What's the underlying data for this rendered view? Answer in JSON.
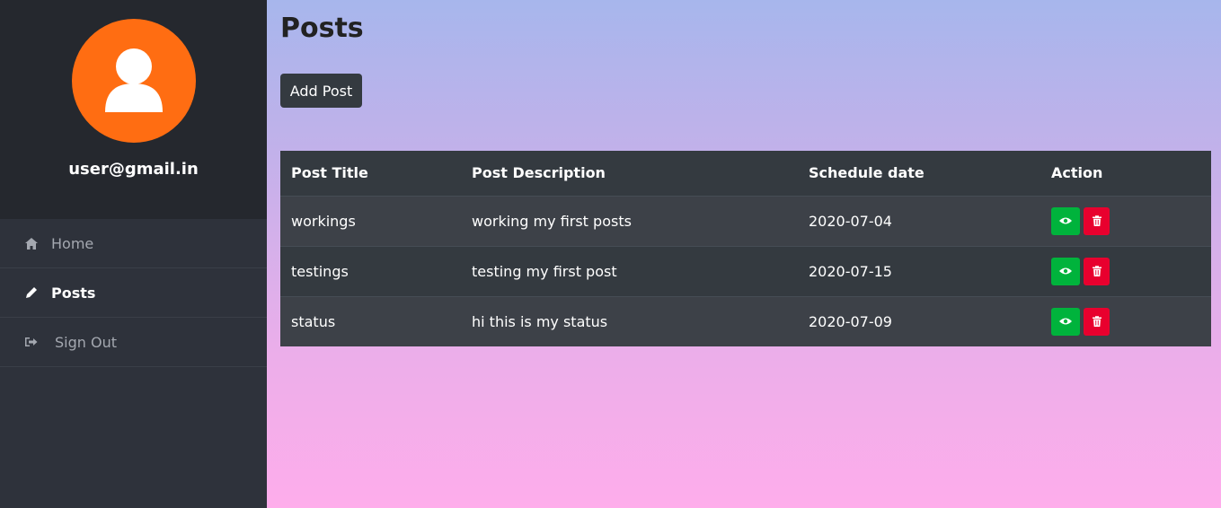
{
  "sidebar": {
    "user_email": "user@gmail.in",
    "items": [
      {
        "label": "Home",
        "icon": "home-icon",
        "active": false
      },
      {
        "label": "Posts",
        "icon": "pencil-icon",
        "active": true
      },
      {
        "label": "Sign Out",
        "icon": "sign-out-icon",
        "active": false
      }
    ]
  },
  "main": {
    "title": "Posts",
    "add_button_label": "Add Post",
    "table": {
      "headers": [
        "Post Title",
        "Post Description",
        "Schedule date",
        "Action"
      ],
      "rows": [
        {
          "title": "workings",
          "description": "working my first posts",
          "date": "2020-07-04"
        },
        {
          "title": "testings",
          "description": "testing my first post",
          "date": "2020-07-15"
        },
        {
          "title": "status",
          "description": "hi this is my status",
          "date": "2020-07-09"
        }
      ]
    }
  },
  "colors": {
    "avatar": "#ff6d12",
    "view_button": "#00b33c",
    "delete_button": "#e8002e",
    "sidebar": "#2e323b"
  }
}
